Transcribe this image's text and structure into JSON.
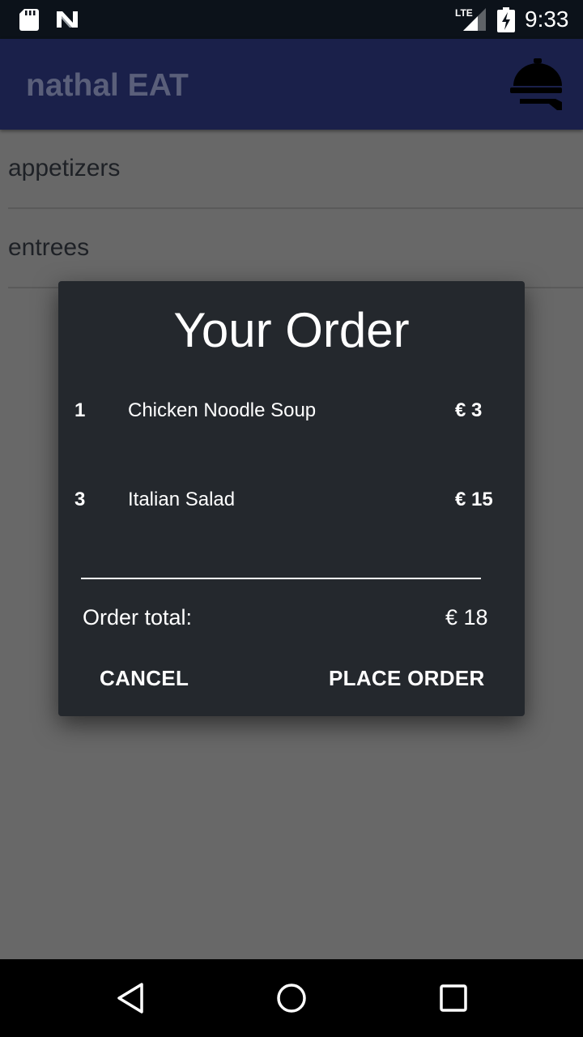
{
  "status_bar": {
    "time": "9:33",
    "network": "LTE"
  },
  "app_bar": {
    "title": "nathal EAT",
    "action_icon": "room-service-tray-icon"
  },
  "categories": [
    {
      "label": "appetizers"
    },
    {
      "label": "entrees"
    }
  ],
  "order_dialog": {
    "title": "Your Order",
    "items": [
      {
        "qty": "1",
        "name": "Chicken Noodle Soup",
        "price": "€ 3"
      },
      {
        "qty": "3",
        "name": "Italian Salad",
        "price": "€ 15"
      }
    ],
    "total_label": "Order total:",
    "total_value": "€ 18",
    "cancel_label": "CANCEL",
    "place_order_label": "PLACE ORDER"
  },
  "colors": {
    "app_bar": "#1a204a",
    "dialog_background": "#24282d",
    "scrim": "#686868"
  },
  "nav_bar": {
    "icons": [
      "back-icon",
      "home-icon",
      "recents-icon"
    ]
  }
}
